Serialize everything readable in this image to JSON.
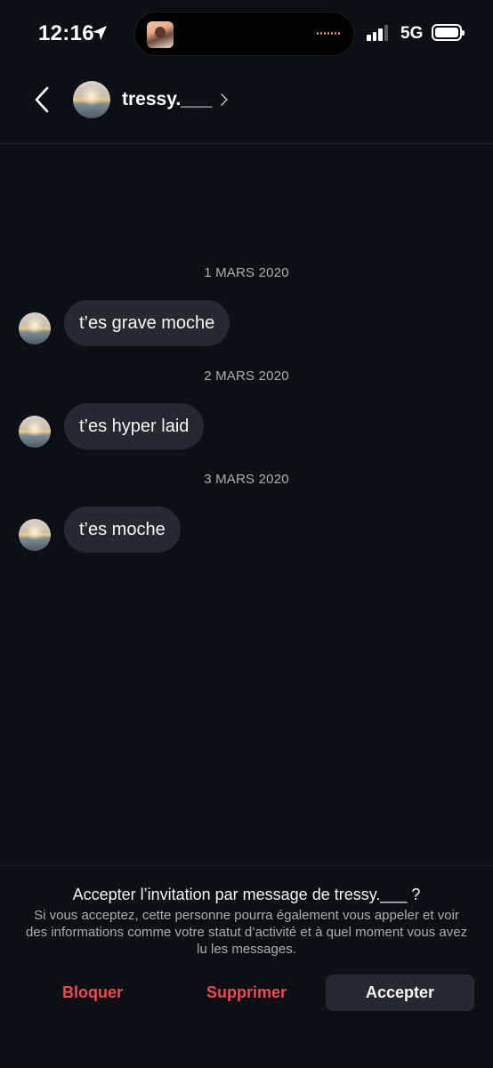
{
  "status_bar": {
    "time": "12:16",
    "location_icon": "location-arrow-icon",
    "network": "5G",
    "signal_bars": 3,
    "signal_bars_total": 4,
    "battery_level": 1.0
  },
  "header": {
    "back_icon": "chevron-left-icon",
    "username": "tressy.___",
    "chevron_icon": "chevron-right-icon"
  },
  "conversation": [
    {
      "date": "1 MARS 2020",
      "message": "t’es grave moche"
    },
    {
      "date": "2 MARS 2020",
      "message": "t’es hyper laid"
    },
    {
      "date": "3 MARS 2020",
      "message": "t’es moche"
    }
  ],
  "invitation": {
    "title": "Accepter l’invitation par message de tressy.___ ?",
    "description": "Si vous acceptez, cette personne pourra également vous appeler et voir des informations comme votre statut d’activité et à quel moment vous avez lu les messages.",
    "block_label": "Bloquer",
    "delete_label": "Supprimer",
    "accept_label": "Accepter"
  },
  "colors": {
    "background": "#0c1014",
    "bubble": "#262a30",
    "danger": "#ed4956",
    "muted_text": "#a8adb3"
  }
}
